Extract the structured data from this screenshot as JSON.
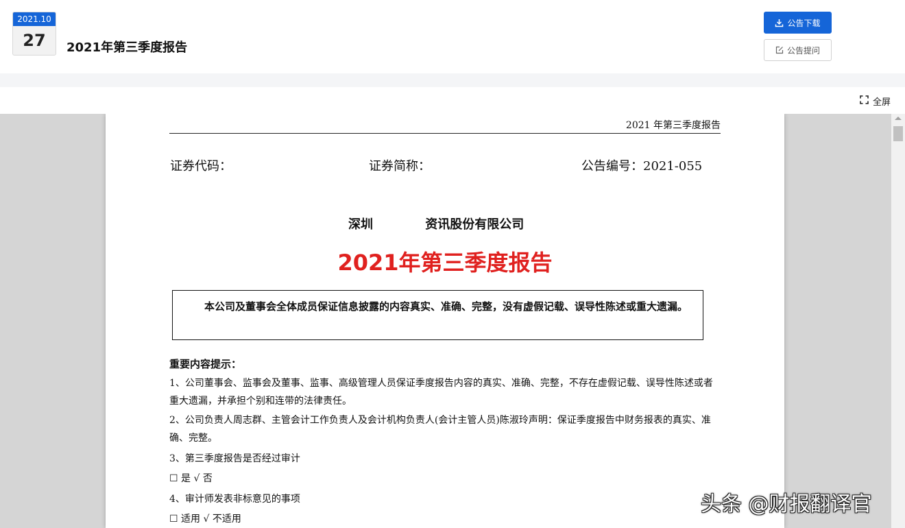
{
  "header": {
    "date_month": "2021.10",
    "date_day": "27",
    "title": "2021年第三季度报告",
    "download_label": "公告下载",
    "question_label": "公告提问",
    "accent_color": "#1565d8"
  },
  "toolbar": {
    "fullscreen_label": "全屏"
  },
  "document": {
    "running_head": "2021 年第三季度报告",
    "stock_code_label": "证券代码：",
    "stock_abbr_label": "证券简称：",
    "announcement_no": "公告编号：2021-055",
    "company_name": "深圳 资讯股份有限公司",
    "report_title": "2021年第三季度报告",
    "title_color": "#e0211f",
    "notice": "本公司及董事会全体成员保证信息披露的内容真实、准确、完整，没有虚假记载、误导性陈述或重大遗漏。",
    "section_title": "重要内容提示：",
    "items": {
      "item1": "1、公司董事会、监事会及董事、监事、高级管理人员保证季度报告内容的真实、准确、完整，不存在虚假记载、误导性陈述或者重大遗漏，并承担个别和连带的法律责任。",
      "item2": "2、公司负责人周志群、主管会计工作负责人及会计机构负责人(会计主管人员)陈淑玲声明：保证季度报告中财务报表的真实、准确、完整。",
      "item3": "3、第三季度报告是否经过审计",
      "item3_options": "☐ 是 √ 否",
      "item4": "4、审计师发表非标意见的事项",
      "item4_options": "☐ 适用 √ 不适用"
    }
  },
  "watermark": "头条 @财报翻译官"
}
